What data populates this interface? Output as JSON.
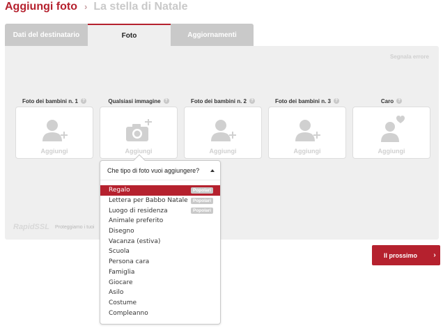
{
  "breadcrumb": {
    "title": "Aggiungi foto",
    "separator": "›",
    "subtitle": "La stella di Natale"
  },
  "tabs": [
    {
      "label": "Dati del destinatario",
      "active": false
    },
    {
      "label": "Foto",
      "active": true
    },
    {
      "label": "Aggiornamenti",
      "active": false
    }
  ],
  "report_link": "Segnala errore",
  "slots": [
    {
      "label": "Foto dei bambini n. 1",
      "action": "Aggiungi",
      "icon": "person-add-icon"
    },
    {
      "label": "Qualsiasi immagine",
      "action": "Aggiungi",
      "icon": "camera-add-icon"
    },
    {
      "label": "Foto dei bambini n. 2",
      "action": "Aggiungi",
      "icon": "person-add-icon"
    },
    {
      "label": "Foto dei bambini n. 3",
      "action": "Aggiungi",
      "icon": "person-add-icon"
    },
    {
      "label": "Caro",
      "action": "Aggiungi",
      "icon": "person-heart-icon"
    }
  ],
  "help_glyph": "?",
  "ssl": {
    "brand": "RapidSSL",
    "note": "Proteggiamo i tuoi"
  },
  "next_button": {
    "label": "Il prossimo",
    "arrow": "›"
  },
  "dropdown": {
    "title": "Che tipo di foto vuoi aggiungere?",
    "items": [
      {
        "label": "Regalo",
        "badge": "Popolari",
        "selected": true
      },
      {
        "label": "Lettera per Babbo Natale",
        "badge": "Popolari",
        "selected": false
      },
      {
        "label": "Luogo di residenza",
        "badge": "Popolari",
        "selected": false
      },
      {
        "label": "Animale preferito",
        "badge": "",
        "selected": false
      },
      {
        "label": "Disegno",
        "badge": "",
        "selected": false
      },
      {
        "label": "Vacanza (estiva)",
        "badge": "",
        "selected": false
      },
      {
        "label": "Scuola",
        "badge": "",
        "selected": false
      },
      {
        "label": "Persona cara",
        "badge": "",
        "selected": false
      },
      {
        "label": "Famiglia",
        "badge": "",
        "selected": false
      },
      {
        "label": "Giocare",
        "badge": "",
        "selected": false
      },
      {
        "label": "Asilo",
        "badge": "",
        "selected": false
      },
      {
        "label": "Costume",
        "badge": "",
        "selected": false
      },
      {
        "label": "Compleanno",
        "badge": "",
        "selected": false
      }
    ]
  },
  "colors": {
    "accent": "#b5212e",
    "tab_inactive": "#c9c9c9",
    "panel_bg": "#efefef",
    "icon_gray": "#d0d0d0",
    "badge_bg": "#c9c9c9"
  }
}
